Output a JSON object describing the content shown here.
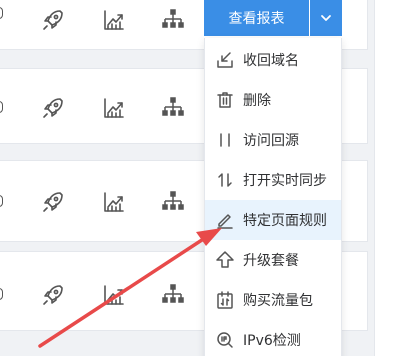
{
  "report_button": {
    "label": "查看报表",
    "color": "#3a8ee6"
  },
  "dropdown": {
    "items": [
      {
        "label": "收回域名",
        "icon": "reclaim-domain-icon"
      },
      {
        "label": "删除",
        "icon": "trash-icon"
      },
      {
        "label": "访问回源",
        "icon": "origin-access-icon"
      },
      {
        "label": "打开实时同步",
        "icon": "sync-arrows-icon"
      },
      {
        "label": "特定页面规则",
        "icon": "edit-pencil-icon",
        "highlighted": true
      },
      {
        "label": "升级套餐",
        "icon": "upgrade-arrow-icon"
      },
      {
        "label": "购买流量包",
        "icon": "traffic-package-icon"
      },
      {
        "label": "IPv6检测",
        "icon": "ipv6-check-icon"
      }
    ]
  },
  "row_icons": [
    "rocket-icon",
    "trend-chart-icon",
    "sitemap-icon"
  ],
  "annotation": {
    "color": "#e84a4a",
    "points_to": "特定页面规则"
  }
}
